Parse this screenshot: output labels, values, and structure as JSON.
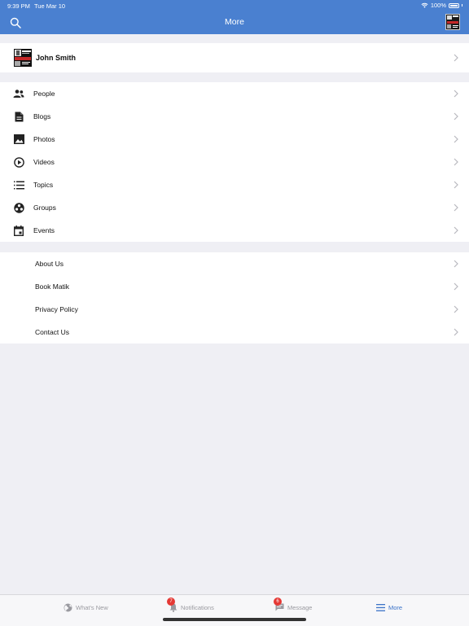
{
  "status_bar": {
    "time": "9:39 PM",
    "date": "Tue Mar 10",
    "battery": "100%"
  },
  "nav": {
    "title": "More"
  },
  "profile": {
    "name": "John Smith"
  },
  "menu_items": [
    {
      "label": "People",
      "icon": "people-icon"
    },
    {
      "label": "Blogs",
      "icon": "document-icon"
    },
    {
      "label": "Photos",
      "icon": "image-icon"
    },
    {
      "label": "Videos",
      "icon": "play-circle-icon"
    },
    {
      "label": "Topics",
      "icon": "list-icon"
    },
    {
      "label": "Groups",
      "icon": "groups-icon"
    },
    {
      "label": "Events",
      "icon": "calendar-icon"
    }
  ],
  "info_items": [
    {
      "label": "About Us"
    },
    {
      "label": "Book Matik"
    },
    {
      "label": "Privacy Policy"
    },
    {
      "label": "Contact Us"
    }
  ],
  "tabs": [
    {
      "label": "What's New",
      "icon": "globe-icon",
      "active": false
    },
    {
      "label": "Notifications",
      "icon": "bell-icon",
      "badge": "7",
      "active": false
    },
    {
      "label": "Message",
      "icon": "chat-icon",
      "badge": "6",
      "active": false
    },
    {
      "label": "More",
      "icon": "menu-icon",
      "active": true
    }
  ],
  "colors": {
    "header": "#4a80d0",
    "active_tab": "#3b73c8",
    "badge": "#e53935"
  }
}
